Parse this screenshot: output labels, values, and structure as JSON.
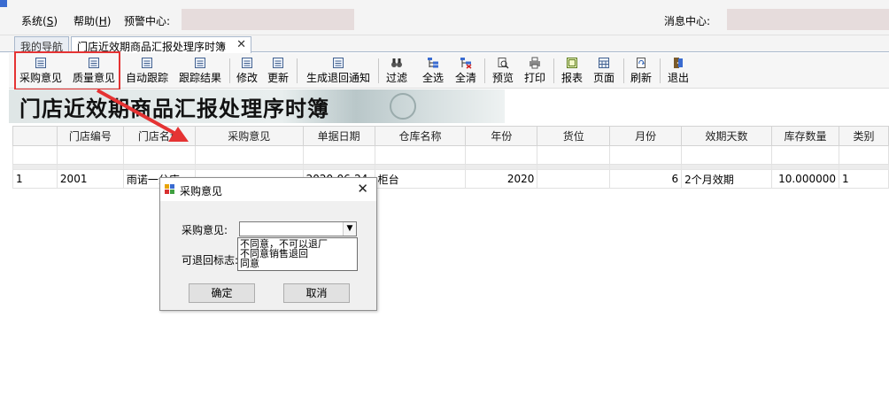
{
  "menubar": {
    "system": "系统(",
    "system_key": "S",
    "help": "帮助(",
    "help_key": "H",
    "close_paren": ")",
    "alert_center": "预警中心:",
    "message_center": "消息中心:"
  },
  "tabs": [
    {
      "label": "我的导航"
    },
    {
      "label": "门店近效期商品汇报处理序时簿",
      "close": "✕"
    }
  ],
  "toolbar": {
    "buttons": [
      {
        "label": "采购意见",
        "icon": "form-icon"
      },
      {
        "label": "质量意见",
        "icon": "form-icon"
      },
      {
        "label": "自动跟踪",
        "icon": "form-icon"
      },
      {
        "label": "跟踪结果",
        "icon": "form-icon"
      },
      {
        "label": "修改",
        "icon": "form-icon"
      },
      {
        "label": "更新",
        "icon": "form-icon"
      },
      {
        "label": "生成退回通知",
        "icon": "form-icon"
      },
      {
        "label": "过滤",
        "icon": "binoculars-icon"
      },
      {
        "label": "全选",
        "icon": "tree-icon"
      },
      {
        "label": "全清",
        "icon": "tree-clear-icon"
      },
      {
        "label": "预览",
        "icon": "preview-icon"
      },
      {
        "label": "打印",
        "icon": "printer-icon"
      },
      {
        "label": "报表",
        "icon": "report-icon"
      },
      {
        "label": "页面",
        "icon": "page-icon"
      },
      {
        "label": "刷新",
        "icon": "refresh-icon"
      },
      {
        "label": "退出",
        "icon": "exit-icon"
      }
    ]
  },
  "banner": {
    "title": "门店近效期商品汇报处理序时簿"
  },
  "grid": {
    "columns": [
      "",
      "门店编号",
      "门店名称",
      "采购意见",
      "单据日期",
      "仓库名称",
      "年份",
      "货位",
      "月份",
      "效期天数",
      "库存数量",
      "类别"
    ],
    "rows": [
      [
        "1",
        "2001",
        "雨诺一分店",
        "",
        "2020-06-24",
        "柜台",
        "2020",
        "",
        "6",
        "2个月效期",
        "10.000000",
        "1"
      ]
    ]
  },
  "dialog": {
    "title": "采购意见",
    "field1_label": "采购意见:",
    "field2_label": "可退回标志:",
    "combo_value": "",
    "options": [
      "不同意，不可以退厂",
      "不同意销售退回",
      "同意"
    ],
    "ok": "确定",
    "cancel": "取消"
  },
  "colors": {
    "highlight": "#e53333",
    "arrow": "#e53333"
  }
}
